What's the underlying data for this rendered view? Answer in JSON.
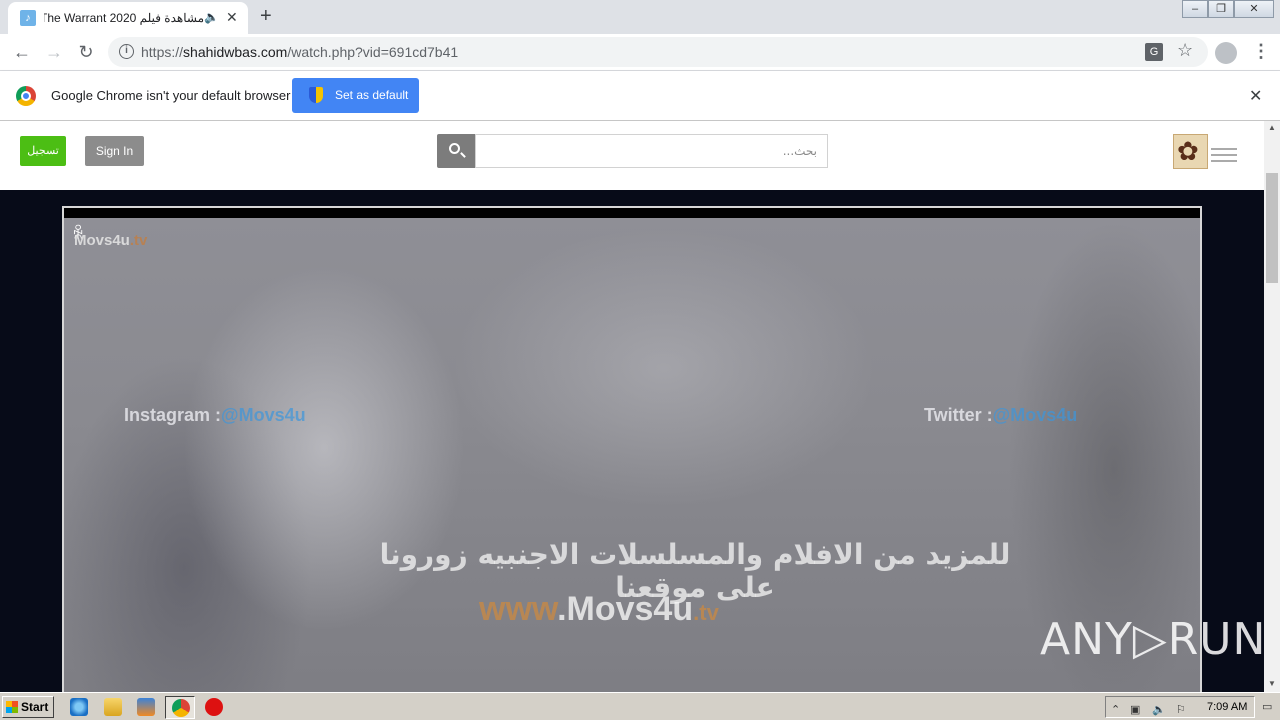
{
  "browser": {
    "tab_title": "مشاهدة فيلم The Warrant 2020",
    "tab_favicon": "♪",
    "url_scheme": "https://",
    "url_host": "shahidwbas.com",
    "url_path": "/watch.php?vid=691cd7b41",
    "translate_glyph": "G"
  },
  "infobar": {
    "message": "Google Chrome isn't your default browser",
    "button_label": "Set as default"
  },
  "site": {
    "register_label": "تسجيل",
    "signin_label": "Sign In",
    "search_placeholder": "بحث..."
  },
  "video": {
    "watermark": "Movs4u",
    "watermark_suffix": ".tv",
    "instagram_label": "Instagram :",
    "instagram_handle": "@Movs4u",
    "twitter_label": "Twitter :",
    "twitter_handle": "@Movs4u",
    "arabic_line": "للمزيد من الافلام والمسلسلات الاجنبيه زورونا على موقعنا",
    "url_prefix": "www",
    "url_main": ".Movs4u",
    "url_suffix": ".tv"
  },
  "overlay": {
    "brand": "ANY▷RUN"
  },
  "taskbar": {
    "start_label": "Start",
    "clock": "7:09 AM"
  }
}
